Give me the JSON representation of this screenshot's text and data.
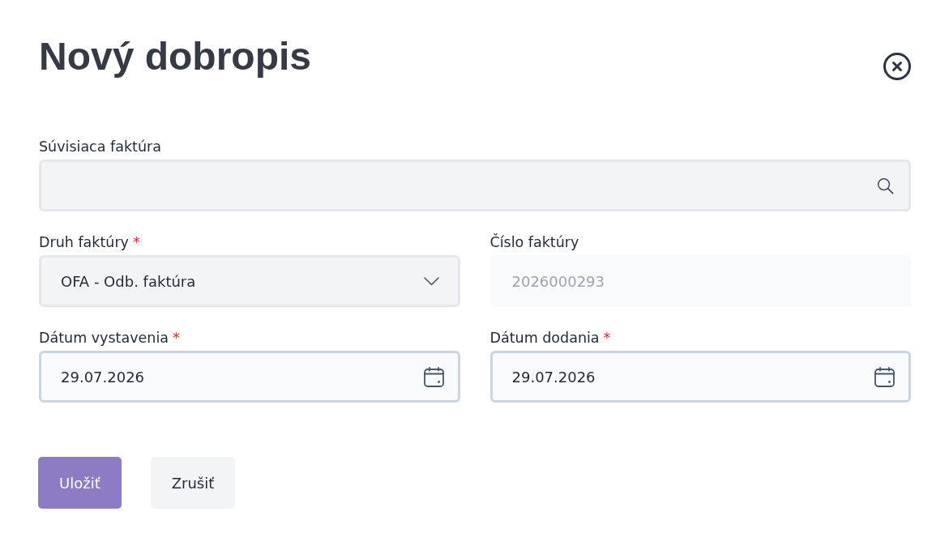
{
  "title": "Nový dobropis",
  "fields": [
    {
      "kind": "search",
      "label": "Súvisiaca faktúra",
      "disabled": false
    },
    {
      "kind": "select",
      "label": "Druh faktúry",
      "required_mark": "*",
      "value": "OFA - Odb. faktúra",
      "disabled": false
    },
    {
      "kind": "text",
      "label": "Číslo faktúry",
      "value": "2026000293",
      "disabled": true
    },
    {
      "kind": "date",
      "label": "Dátum vystavenia",
      "required_mark": "*",
      "value": "29.07.2026",
      "disabled": false
    },
    {
      "kind": "date",
      "label": "Dátum dodania",
      "required_mark": "*",
      "value": "29.07.2026",
      "disabled": false
    }
  ],
  "buttons": [
    {
      "kind": "primary",
      "label": "Uložiť"
    },
    {
      "kind": "secondary",
      "label": "Zrušiť"
    }
  ]
}
